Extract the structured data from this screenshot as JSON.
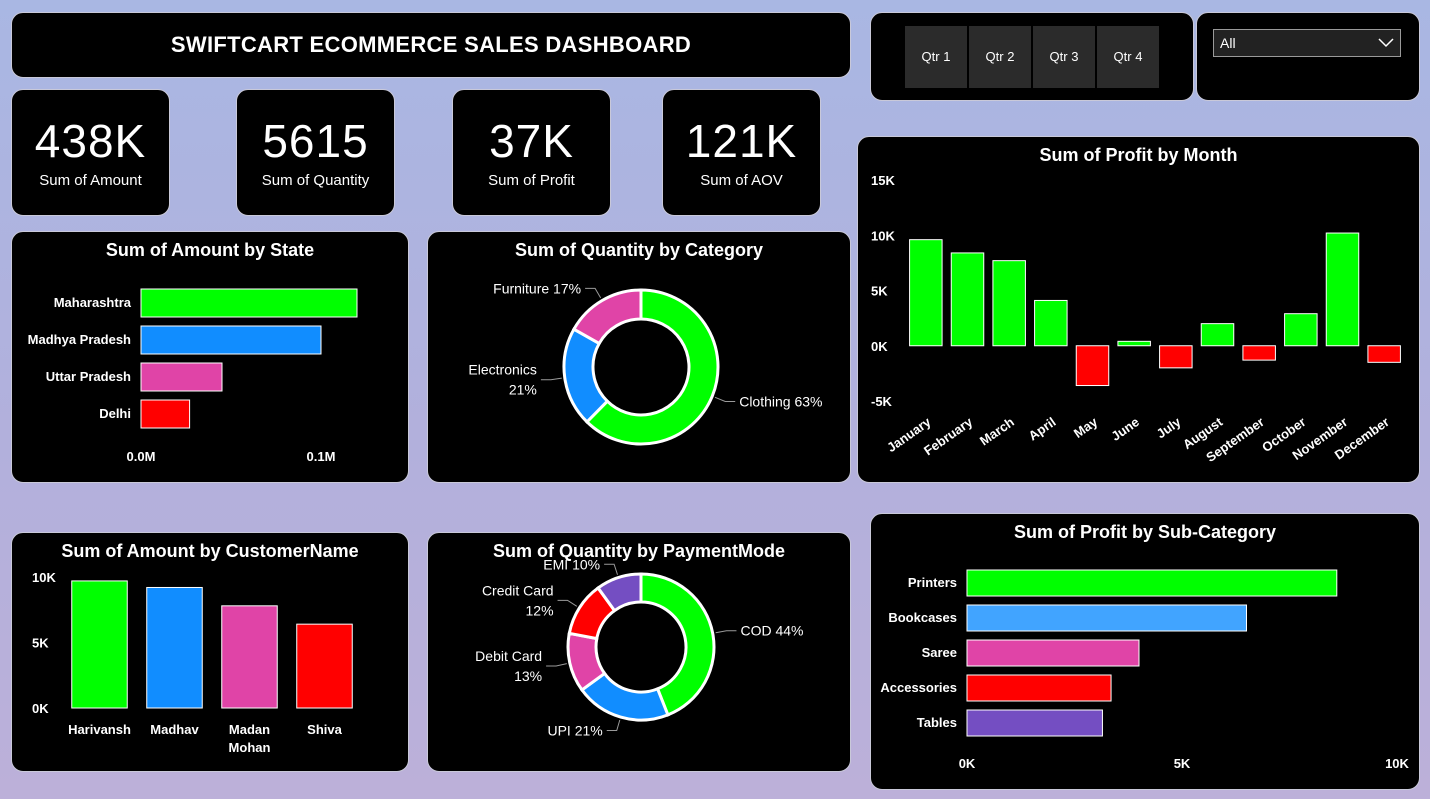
{
  "header": {
    "title": "SWIFTCART ECOMMERCE SALES DASHBOARD"
  },
  "slicer": {
    "quarters": [
      "Qtr 1",
      "Qtr 2",
      "Qtr 3",
      "Qtr 4"
    ],
    "dropdown_value": "All",
    "dropdown_icon": "chevron-down-icon"
  },
  "kpis": [
    {
      "value": "438K",
      "label": "Sum of Amount"
    },
    {
      "value": "5615",
      "label": "Sum of Quantity"
    },
    {
      "value": "37K",
      "label": "Sum of Profit"
    },
    {
      "value": "121K",
      "label": "Sum of AOV"
    }
  ],
  "chart_data": [
    {
      "id": "amount_by_state",
      "type": "bar",
      "orientation": "horizontal",
      "title": "Sum of Amount by State",
      "categories": [
        "Maharashtra",
        "Madhya Pradesh",
        "Uttar Pradesh",
        "Delhi"
      ],
      "values": [
        0.12,
        0.1,
        0.045,
        0.027
      ],
      "colors": [
        "#00ff00",
        "#118dff",
        "#e044a7",
        "#ff0000"
      ],
      "xlim": [
        0,
        0.15
      ],
      "xticks": [
        {
          "value": 0,
          "label": "0.0M"
        },
        {
          "value": 0.1,
          "label": "0.1M"
        }
      ],
      "unit": "M"
    },
    {
      "id": "quantity_by_category",
      "type": "pie",
      "donut": true,
      "title": "Sum of Quantity by Category",
      "categories": [
        "Clothing",
        "Electronics",
        "Furniture"
      ],
      "values": [
        63,
        21,
        17
      ],
      "colors": [
        "#00ff00",
        "#118dff",
        "#e044a7"
      ],
      "labels": [
        [
          "Clothing 63%"
        ],
        [
          "Electronics",
          "21%"
        ],
        [
          "Furniture 17%"
        ]
      ]
    },
    {
      "id": "profit_by_month",
      "type": "bar",
      "orientation": "vertical",
      "title": "Sum of Profit by Month",
      "categories": [
        "January",
        "February",
        "March",
        "April",
        "May",
        "June",
        "July",
        "August",
        "September",
        "October",
        "November",
        "December"
      ],
      "values": [
        9600,
        8400,
        7700,
        4100,
        -3600,
        400,
        -2000,
        2000,
        -1300,
        2900,
        10200,
        -1500
      ],
      "positive_color": "#00ff00",
      "negative_color": "#ff0000",
      "ylim": [
        -5000,
        15000
      ],
      "yticks": [
        {
          "value": 15000,
          "label": "15K"
        },
        {
          "value": 10000,
          "label": "10K"
        },
        {
          "value": 5000,
          "label": "5K"
        },
        {
          "value": 0,
          "label": "0K"
        },
        {
          "value": -5000,
          "label": "-5K"
        }
      ]
    },
    {
      "id": "amount_by_customer",
      "type": "bar",
      "orientation": "vertical",
      "title": "Sum of Amount by CustomerName",
      "categories": [
        [
          "Harivansh"
        ],
        [
          "Madhav"
        ],
        [
          "Madan",
          "Mohan"
        ],
        [
          "Shiva"
        ]
      ],
      "values": [
        9700,
        9200,
        7800,
        6400
      ],
      "colors": [
        "#00ff00",
        "#118dff",
        "#e044a7",
        "#ff0000"
      ],
      "ylim": [
        0,
        10000
      ],
      "yticks": [
        {
          "value": 10000,
          "label": "10K"
        },
        {
          "value": 5000,
          "label": "5K"
        },
        {
          "value": 0,
          "label": "0K"
        }
      ]
    },
    {
      "id": "quantity_by_payment",
      "type": "pie",
      "donut": true,
      "title": "Sum of Quantity by PaymentMode",
      "categories": [
        "COD",
        "UPI",
        "Debit Card",
        "Credit Card",
        "EMI"
      ],
      "values": [
        44,
        21,
        13,
        12,
        10
      ],
      "colors": [
        "#00ff00",
        "#118dff",
        "#e044a7",
        "#ff0000",
        "#744ec2"
      ],
      "labels": [
        [
          "COD 44%"
        ],
        [
          "UPI 21%"
        ],
        [
          "Debit Card",
          "13%"
        ],
        [
          "Credit Card",
          "12%"
        ],
        [
          "EMI 10%"
        ]
      ]
    },
    {
      "id": "profit_by_subcategory",
      "type": "bar",
      "orientation": "horizontal",
      "title": "Sum of Profit by Sub-Category",
      "categories": [
        "Printers",
        "Bookcases",
        "Saree",
        "Accessories",
        "Tables"
      ],
      "values": [
        8600,
        6500,
        4000,
        3350,
        3150
      ],
      "colors": [
        "#00ff00",
        "#41a4ff",
        "#e044a7",
        "#ff0000",
        "#744ec2"
      ],
      "xlim": [
        0,
        10000
      ],
      "xticks": [
        {
          "value": 0,
          "label": "0K"
        },
        {
          "value": 5000,
          "label": "5K"
        },
        {
          "value": 10000,
          "label": "10K"
        }
      ]
    }
  ]
}
